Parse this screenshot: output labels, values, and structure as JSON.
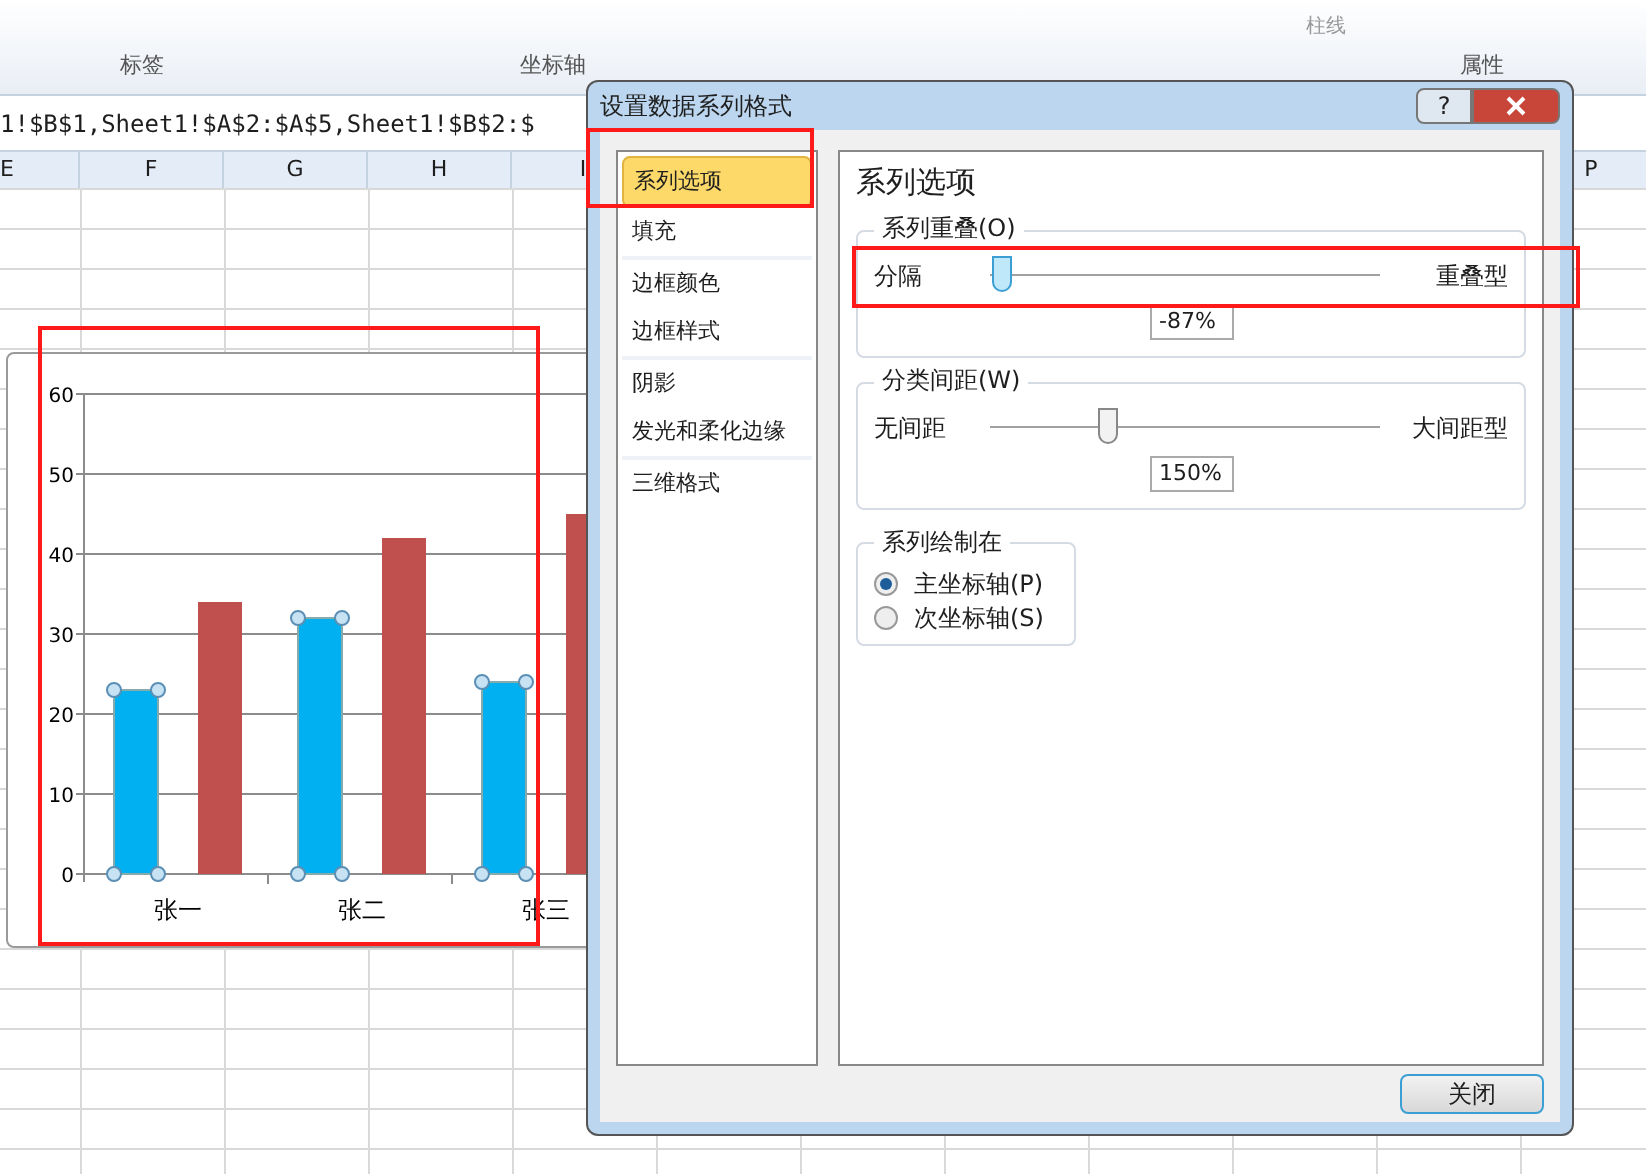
{
  "ribbon": {
    "subitem": "柱线",
    "groups": [
      "标签",
      "坐标轴",
      "属性"
    ]
  },
  "formula_bar": {
    "text": "1!$B$1,Sheet1!$A$2:$A$5,Sheet1!$B$2:$"
  },
  "columns": [
    "E",
    "F",
    "G",
    "H",
    "I",
    "P"
  ],
  "chart": {
    "chart_data": {
      "type": "bar",
      "categories": [
        "张一",
        "张二",
        "张三"
      ],
      "series": [
        {
          "color": "#00b0f0",
          "values": [
            23,
            32,
            24
          ]
        },
        {
          "color": "#c0504d",
          "values": [
            34,
            42,
            45
          ]
        }
      ],
      "ylim": [
        0,
        60
      ],
      "yticks": [
        0,
        10,
        20,
        30,
        40,
        50,
        60
      ],
      "grid": true
    },
    "series_state": [
      {
        "selected": true
      },
      {
        "selected": false
      }
    ]
  },
  "dialog": {
    "title": "设置数据系列格式",
    "help": "?",
    "nav": [
      {
        "label": "系列选项",
        "selected": true
      },
      {
        "label": "填充",
        "selected": false
      },
      {
        "label": "边框颜色",
        "selected": false
      },
      {
        "label": "边框样式",
        "selected": false
      },
      {
        "label": "阴影",
        "selected": false
      },
      {
        "label": "发光和柔化边缘",
        "selected": false
      },
      {
        "label": "三维格式",
        "selected": false
      }
    ],
    "heading": "系列选项",
    "sliders": [
      {
        "label": "系列重叠(O)",
        "left": "分隔",
        "right": "重叠型",
        "level": 0.03,
        "value": "-87%",
        "highlighted": true
      },
      {
        "label": "分类间距(W)",
        "left": "无间距",
        "right": "大间距型",
        "level": 0.3,
        "value": "150%",
        "highlighted": false
      }
    ],
    "plot_on": {
      "label": "系列绘制在",
      "options": [
        {
          "label": "主坐标轴(P)",
          "selected": true
        },
        {
          "label": "次坐标轴(S)",
          "selected": false
        }
      ]
    },
    "close_button": "关闭"
  }
}
